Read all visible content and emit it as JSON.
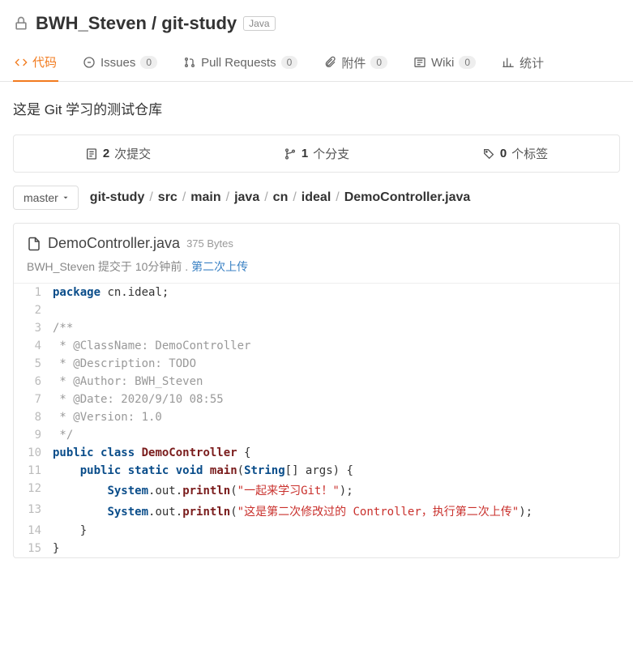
{
  "header": {
    "owner": "BWH_Steven",
    "repo": "git-study",
    "lang_badge": "Java"
  },
  "tabs": {
    "code": "代码",
    "issues": {
      "label": "Issues",
      "count": "0"
    },
    "pulls": {
      "label": "Pull Requests",
      "count": "0"
    },
    "attach": {
      "label": "附件",
      "count": "0"
    },
    "wiki": {
      "label": "Wiki",
      "count": "0"
    },
    "stats": "统计"
  },
  "description": "这是 Git 学习的测试仓库",
  "stats_bar": {
    "commits": {
      "count": "2",
      "label": "次提交"
    },
    "branches": {
      "count": "1",
      "label": "个分支"
    },
    "tags": {
      "count": "0",
      "label": "个标签"
    }
  },
  "branch_selector": {
    "label": "master"
  },
  "breadcrumbs": [
    "git-study",
    "src",
    "main",
    "java",
    "cn",
    "ideal",
    "DemoController.java"
  ],
  "file": {
    "name": "DemoController.java",
    "size": "375 Bytes",
    "author": "BWH_Steven",
    "committed": "提交于 10分钟前 .",
    "commit_msg": "第二次上传"
  },
  "code_lines": [
    [
      [
        "kw",
        "package "
      ],
      [
        "pln",
        "cn"
      ],
      [
        "pln",
        "."
      ],
      [
        "pln",
        "ideal"
      ],
      [
        "pln",
        ";"
      ]
    ],
    [],
    [
      [
        "cmt",
        "/**"
      ]
    ],
    [
      [
        "cmt",
        " * @ClassName: DemoController"
      ]
    ],
    [
      [
        "cmt",
        " * @Description: TODO"
      ]
    ],
    [
      [
        "cmt",
        " * @Author: BWH_Steven"
      ]
    ],
    [
      [
        "cmt",
        " * @Date: 2020/9/10 08:55"
      ]
    ],
    [
      [
        "cmt",
        " * @Version: 1.0"
      ]
    ],
    [
      [
        "cmt",
        " */"
      ]
    ],
    [
      [
        "kw",
        "public "
      ],
      [
        "kw",
        "class "
      ],
      [
        "cls",
        "DemoController"
      ],
      [
        "pln",
        " {"
      ]
    ],
    [
      [
        "pln",
        "    "
      ],
      [
        "kw",
        "public "
      ],
      [
        "kw",
        "static "
      ],
      [
        "kw",
        "void "
      ],
      [
        "fn",
        "main"
      ],
      [
        "pln",
        "("
      ],
      [
        "type",
        "String"
      ],
      [
        "pln",
        "[] args) {"
      ]
    ],
    [
      [
        "pln",
        "        "
      ],
      [
        "type",
        "System"
      ],
      [
        "pln",
        "."
      ],
      [
        "pln",
        "out"
      ],
      [
        "pln",
        "."
      ],
      [
        "fn",
        "println"
      ],
      [
        "pln",
        "("
      ],
      [
        "str",
        "\"一起来学习Git！\""
      ],
      [
        "pln",
        ");"
      ]
    ],
    [
      [
        "pln",
        "        "
      ],
      [
        "type",
        "System"
      ],
      [
        "pln",
        "."
      ],
      [
        "pln",
        "out"
      ],
      [
        "pln",
        "."
      ],
      [
        "fn",
        "println"
      ],
      [
        "pln",
        "("
      ],
      [
        "str",
        "\"这是第二次修改过的 Controller，执行第二次上传\""
      ],
      [
        "pln",
        ");"
      ]
    ],
    [
      [
        "pln",
        "    }"
      ]
    ],
    [
      [
        "pln",
        "}"
      ]
    ]
  ]
}
